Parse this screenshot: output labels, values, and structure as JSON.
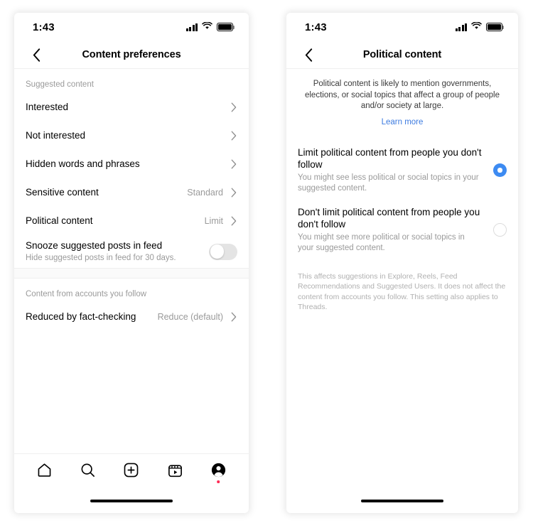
{
  "left_phone": {
    "status_bar": {
      "time": "1:43",
      "signal_icon": "cellular-signal-icon",
      "wifi_icon": "wifi-icon",
      "battery_icon": "battery-full-icon"
    },
    "nav": {
      "back_icon": "chevron-left-icon",
      "title": "Content preferences"
    },
    "sections": [
      {
        "header": "Suggested content",
        "rows": [
          {
            "label": "Interested",
            "value": "",
            "type": "chevron"
          },
          {
            "label": "Not interested",
            "value": "",
            "type": "chevron"
          },
          {
            "label": "Hidden words and phrases",
            "value": "",
            "type": "chevron"
          },
          {
            "label": "Sensitive content",
            "value": "Standard",
            "type": "chevron"
          },
          {
            "label": "Political content",
            "value": "Limit",
            "type": "chevron"
          },
          {
            "label": "Snooze suggested posts in feed",
            "sublabel": "Hide suggested posts in feed for 30 days.",
            "value": "",
            "type": "toggle",
            "toggle_on": false
          }
        ]
      },
      {
        "header": "Content from accounts you follow",
        "rows": [
          {
            "label": "Reduced by fact-checking",
            "value": "Reduce (default)",
            "type": "chevron"
          }
        ]
      }
    ],
    "tab_bar": {
      "items": [
        {
          "icon": "home-icon",
          "label": "Home",
          "badge": false
        },
        {
          "icon": "search-icon",
          "label": "Search",
          "badge": false
        },
        {
          "icon": "create-post-icon",
          "label": "Create",
          "badge": false
        },
        {
          "icon": "reels-icon",
          "label": "Reels",
          "badge": false
        },
        {
          "icon": "profile-icon",
          "label": "Profile",
          "badge": true
        }
      ]
    }
  },
  "right_phone": {
    "status_bar": {
      "time": "1:43",
      "signal_icon": "cellular-signal-icon",
      "wifi_icon": "wifi-icon",
      "battery_icon": "battery-full-icon"
    },
    "nav": {
      "back_icon": "chevron-left-icon",
      "title": "Political content"
    },
    "intro": {
      "description": "Political content is likely to mention governments, elections, or social topics that affect a group of people and/or society at large.",
      "learn_more": "Learn more"
    },
    "options": [
      {
        "title": "Limit political content from people you don't follow",
        "description": "You might see less political or social topics in your suggested content.",
        "selected": true
      },
      {
        "title": "Don't limit political content from people you don't follow",
        "description": "You might see more political or social topics in your suggested content.",
        "selected": false
      }
    ],
    "footnote": "This affects suggestions in Explore, Reels, Feed Recommendations and Suggested Users. It does not affect the content from accounts you follow. This setting also applies to Threads."
  },
  "colors": {
    "accent_blue": "#3d8bf2",
    "link_blue": "#3d7be0",
    "badge_red": "#fe2c55",
    "muted_text": "#9a9a9a"
  }
}
